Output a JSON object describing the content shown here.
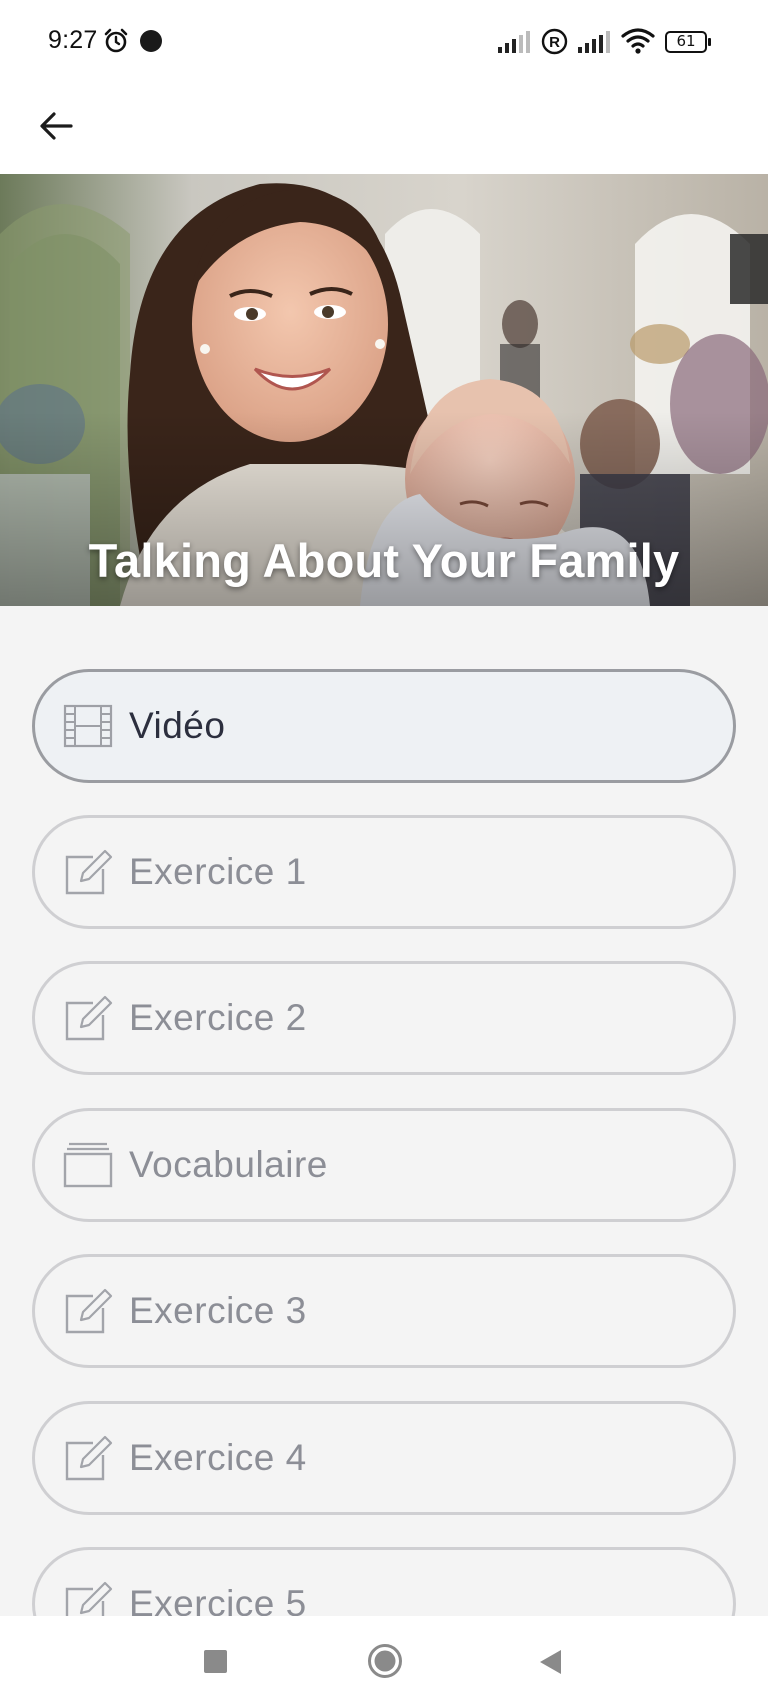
{
  "status_bar": {
    "time": "9:27",
    "battery": "61",
    "icons": [
      "alarm-icon",
      "notification-dot-icon",
      "signal-icon",
      "registered-icon",
      "signal-icon",
      "wifi-icon",
      "battery-icon"
    ]
  },
  "header": {
    "back_icon": "arrow-left-icon"
  },
  "hero": {
    "title": "Talking About Your Family"
  },
  "menu": {
    "items": [
      {
        "label": "Vidéo",
        "icon": "film-icon",
        "active": true
      },
      {
        "label": "Exercice 1",
        "icon": "edit-icon",
        "active": false
      },
      {
        "label": "Exercice 2",
        "icon": "edit-icon",
        "active": false
      },
      {
        "label": "Vocabulaire",
        "icon": "cards-icon",
        "active": false
      },
      {
        "label": "Exercice 3",
        "icon": "edit-icon",
        "active": false
      },
      {
        "label": "Exercice 4",
        "icon": "edit-icon",
        "active": false
      },
      {
        "label": "Exercice 5",
        "icon": "edit-icon",
        "active": false
      }
    ]
  },
  "nav_bar": {
    "icons": [
      "recents-square-icon",
      "home-circle-icon",
      "back-triangle-icon"
    ]
  },
  "colors": {
    "background": "#f4f4f4",
    "active_border": "#9a9ca1",
    "inactive_border": "#cfcfd2",
    "active_text": "#2c2f3e",
    "inactive_text": "#8c8e96"
  }
}
